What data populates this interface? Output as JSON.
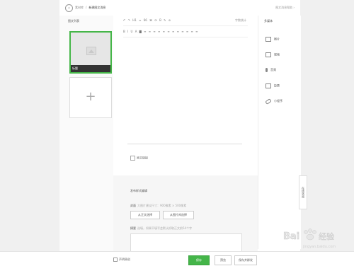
{
  "header": {
    "breadcrumb": [
      "素材库",
      "新建图文消息"
    ],
    "right_link": "图文消息帮助 ›"
  },
  "left_panel": {
    "title": "图文列表",
    "thumb_caption": "标题",
    "add_symbol": "+"
  },
  "editor": {
    "toolbar_row1": [
      "↶",
      "↷",
      "H1",
      "≡",
      "66",
      "⌘",
      "⟳",
      "B",
      "✎",
      "⊘"
    ],
    "toolbar_row2": [
      "B",
      "I",
      "U",
      "A",
      "▇",
      "≡",
      "≡",
      "≡",
      "≡",
      "≡",
      "≡",
      "≡",
      "≡",
      "≡",
      "≡",
      "≡",
      "≡"
    ],
    "toolbar_right": "字数统计",
    "original_label": "原文链接"
  },
  "publish": {
    "title": "发布样式编辑",
    "cover_label": "封面",
    "cover_hint": "大图片建议尺寸：900像素 × 500像素",
    "btn_from_body": "从正文选择",
    "btn_from_library": "从图片库选择",
    "abstract_label": "摘要",
    "abstract_hint": "选填，如果不填写会默认抓取正文前54个字"
  },
  "right_panel": {
    "title": "多媒体",
    "items": [
      {
        "label": "图片",
        "icon": "image-icon"
      },
      {
        "label": "视频",
        "icon": "video-icon"
      },
      {
        "label": "音频",
        "icon": "audio-icon"
      },
      {
        "label": "投票",
        "icon": "vote-icon"
      },
      {
        "label": "小程序",
        "icon": "mini-program-icon"
      }
    ]
  },
  "side_tab": "在线咨询",
  "footer": {
    "checkbox_label": "声明原创",
    "save": "保存",
    "preview": "预览",
    "send": "保存并群发"
  },
  "watermark": {
    "brand": "Bai",
    "brand_suffix": "经验",
    "url": "jingyan.baidu.com"
  },
  "colors": {
    "accent": "#44b549",
    "background": "#f0f0f0"
  }
}
